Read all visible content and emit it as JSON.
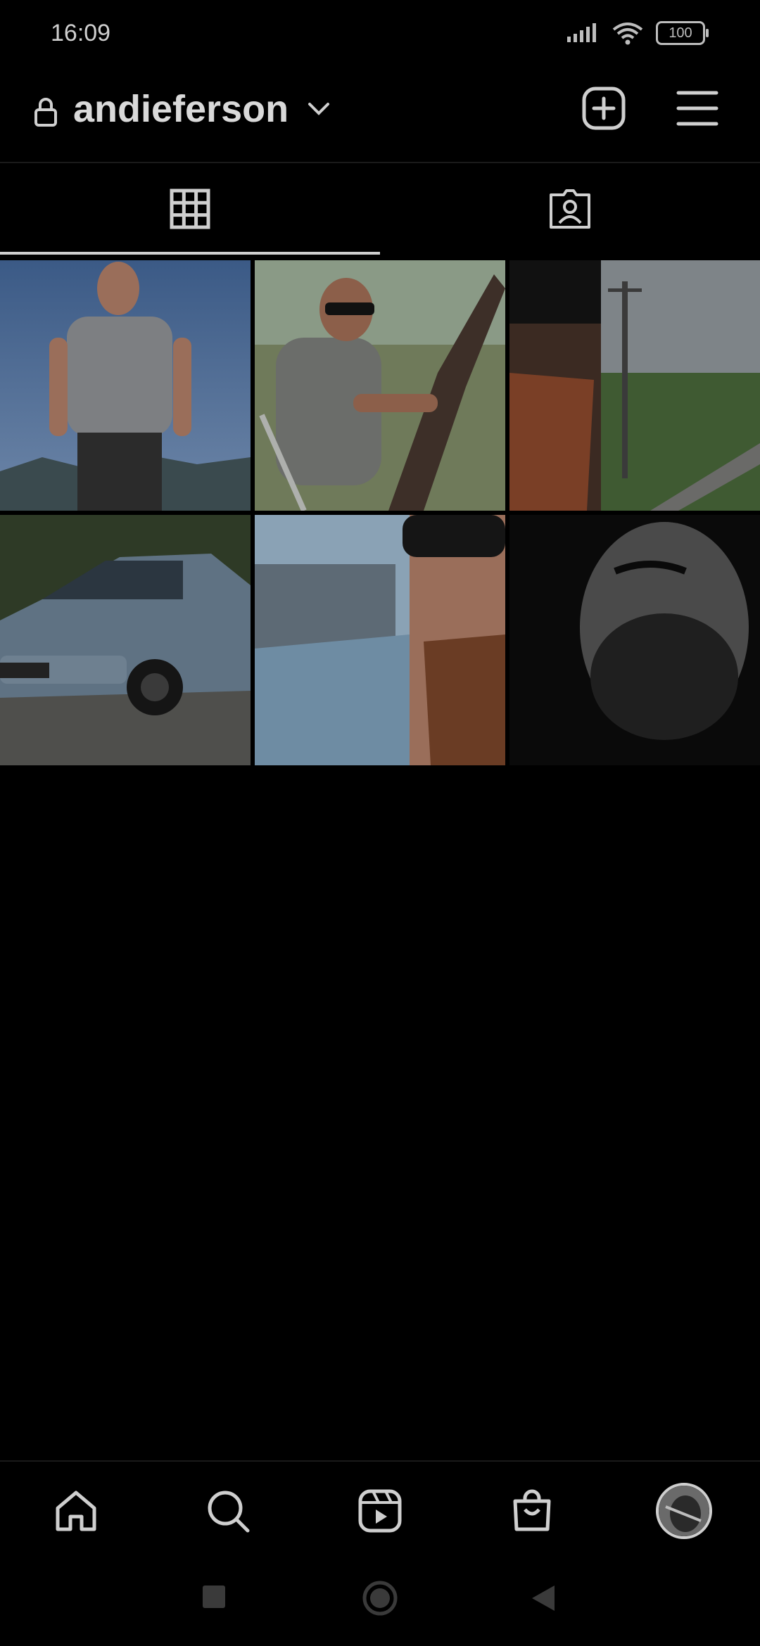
{
  "status_bar": {
    "time": "16:09",
    "battery": "100",
    "icons": [
      "signal-icon",
      "wifi-icon",
      "battery-icon"
    ]
  },
  "header": {
    "username": "andieferson",
    "icons": [
      "lock-icon",
      "chevron-down-icon",
      "add-post-icon",
      "menu-icon"
    ]
  },
  "tabs": [
    {
      "name": "grid",
      "icon": "grid-icon",
      "selected": true
    },
    {
      "name": "tagged",
      "icon": "tagged-person-icon",
      "selected": false
    }
  ],
  "posts": [
    {
      "id": "post-1",
      "description": "man in grey t-shirt on mountain"
    },
    {
      "id": "post-2",
      "description": "man with sunglasses seated by tree"
    },
    {
      "id": "post-3",
      "description": "face close-up with road and utility pole"
    },
    {
      "id": "post-4",
      "description": "blue-grey hatchback car"
    },
    {
      "id": "post-5",
      "description": "selfie with blue car"
    },
    {
      "id": "post-6",
      "description": "black and white portrait"
    }
  ],
  "bottom_nav": {
    "items": [
      "home-icon",
      "search-icon",
      "reels-icon",
      "shop-icon",
      "profile-avatar"
    ]
  },
  "system_nav": {
    "items": [
      "recent-apps-button",
      "home-button",
      "back-button"
    ]
  },
  "colors": {
    "background": "#000000",
    "text": "#d9d9d9",
    "icon": "#cfcfcf"
  }
}
